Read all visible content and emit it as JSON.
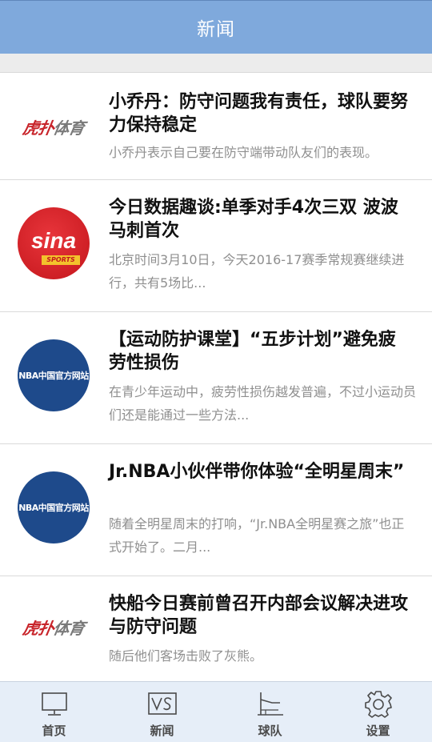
{
  "header": {
    "title": "新闻"
  },
  "news": [
    {
      "source_logo": "hupu-logo",
      "logo_text": [
        "虎扑",
        "体育"
      ],
      "title": "小乔丹：防守问题我有责任，球队要努力保持稳定",
      "summary": "小乔丹表示自己要在防守端带动队友们的表现。"
    },
    {
      "source_logo": "sina-sports-logo",
      "logo_text": [
        "sina",
        "SPORTS"
      ],
      "title": "今日数据趣谈:单季对手4次三双 波波马刺首次",
      "summary": "北京时间3月10日，今天2016-17赛季常规赛继续进行，共有5场比..."
    },
    {
      "source_logo": "nba-china-logo",
      "logo_text": [
        "NBA中国官方网站"
      ],
      "title": "【运动防护课堂】“五步计划”避免疲劳性损伤",
      "summary": "在青少年运动中，疲劳性损伤越发普遍，不过小运动员们还是能通过一些方法..."
    },
    {
      "source_logo": "nba-china-logo",
      "logo_text": [
        "NBA中国官方网站"
      ],
      "title": "Jr.NBA小伙伴带你体验“全明星周末”",
      "summary": "随着全明星周末的打响，“Jr.NBA全明星赛之旅”也正式开始了。二月..."
    },
    {
      "source_logo": "hupu-logo",
      "logo_text": [
        "虎扑",
        "体育"
      ],
      "title": "快船今日赛前曾召开内部会议解决进攻与防守问题",
      "summary": "随后他们客场击败了灰熊。"
    }
  ],
  "tabbar": {
    "tabs": [
      {
        "label": "首页",
        "icon": "monitor-icon"
      },
      {
        "label": "新闻",
        "icon": "vs-icon"
      },
      {
        "label": "球队",
        "icon": "court-icon"
      },
      {
        "label": "设置",
        "icon": "gear-icon"
      }
    ]
  }
}
